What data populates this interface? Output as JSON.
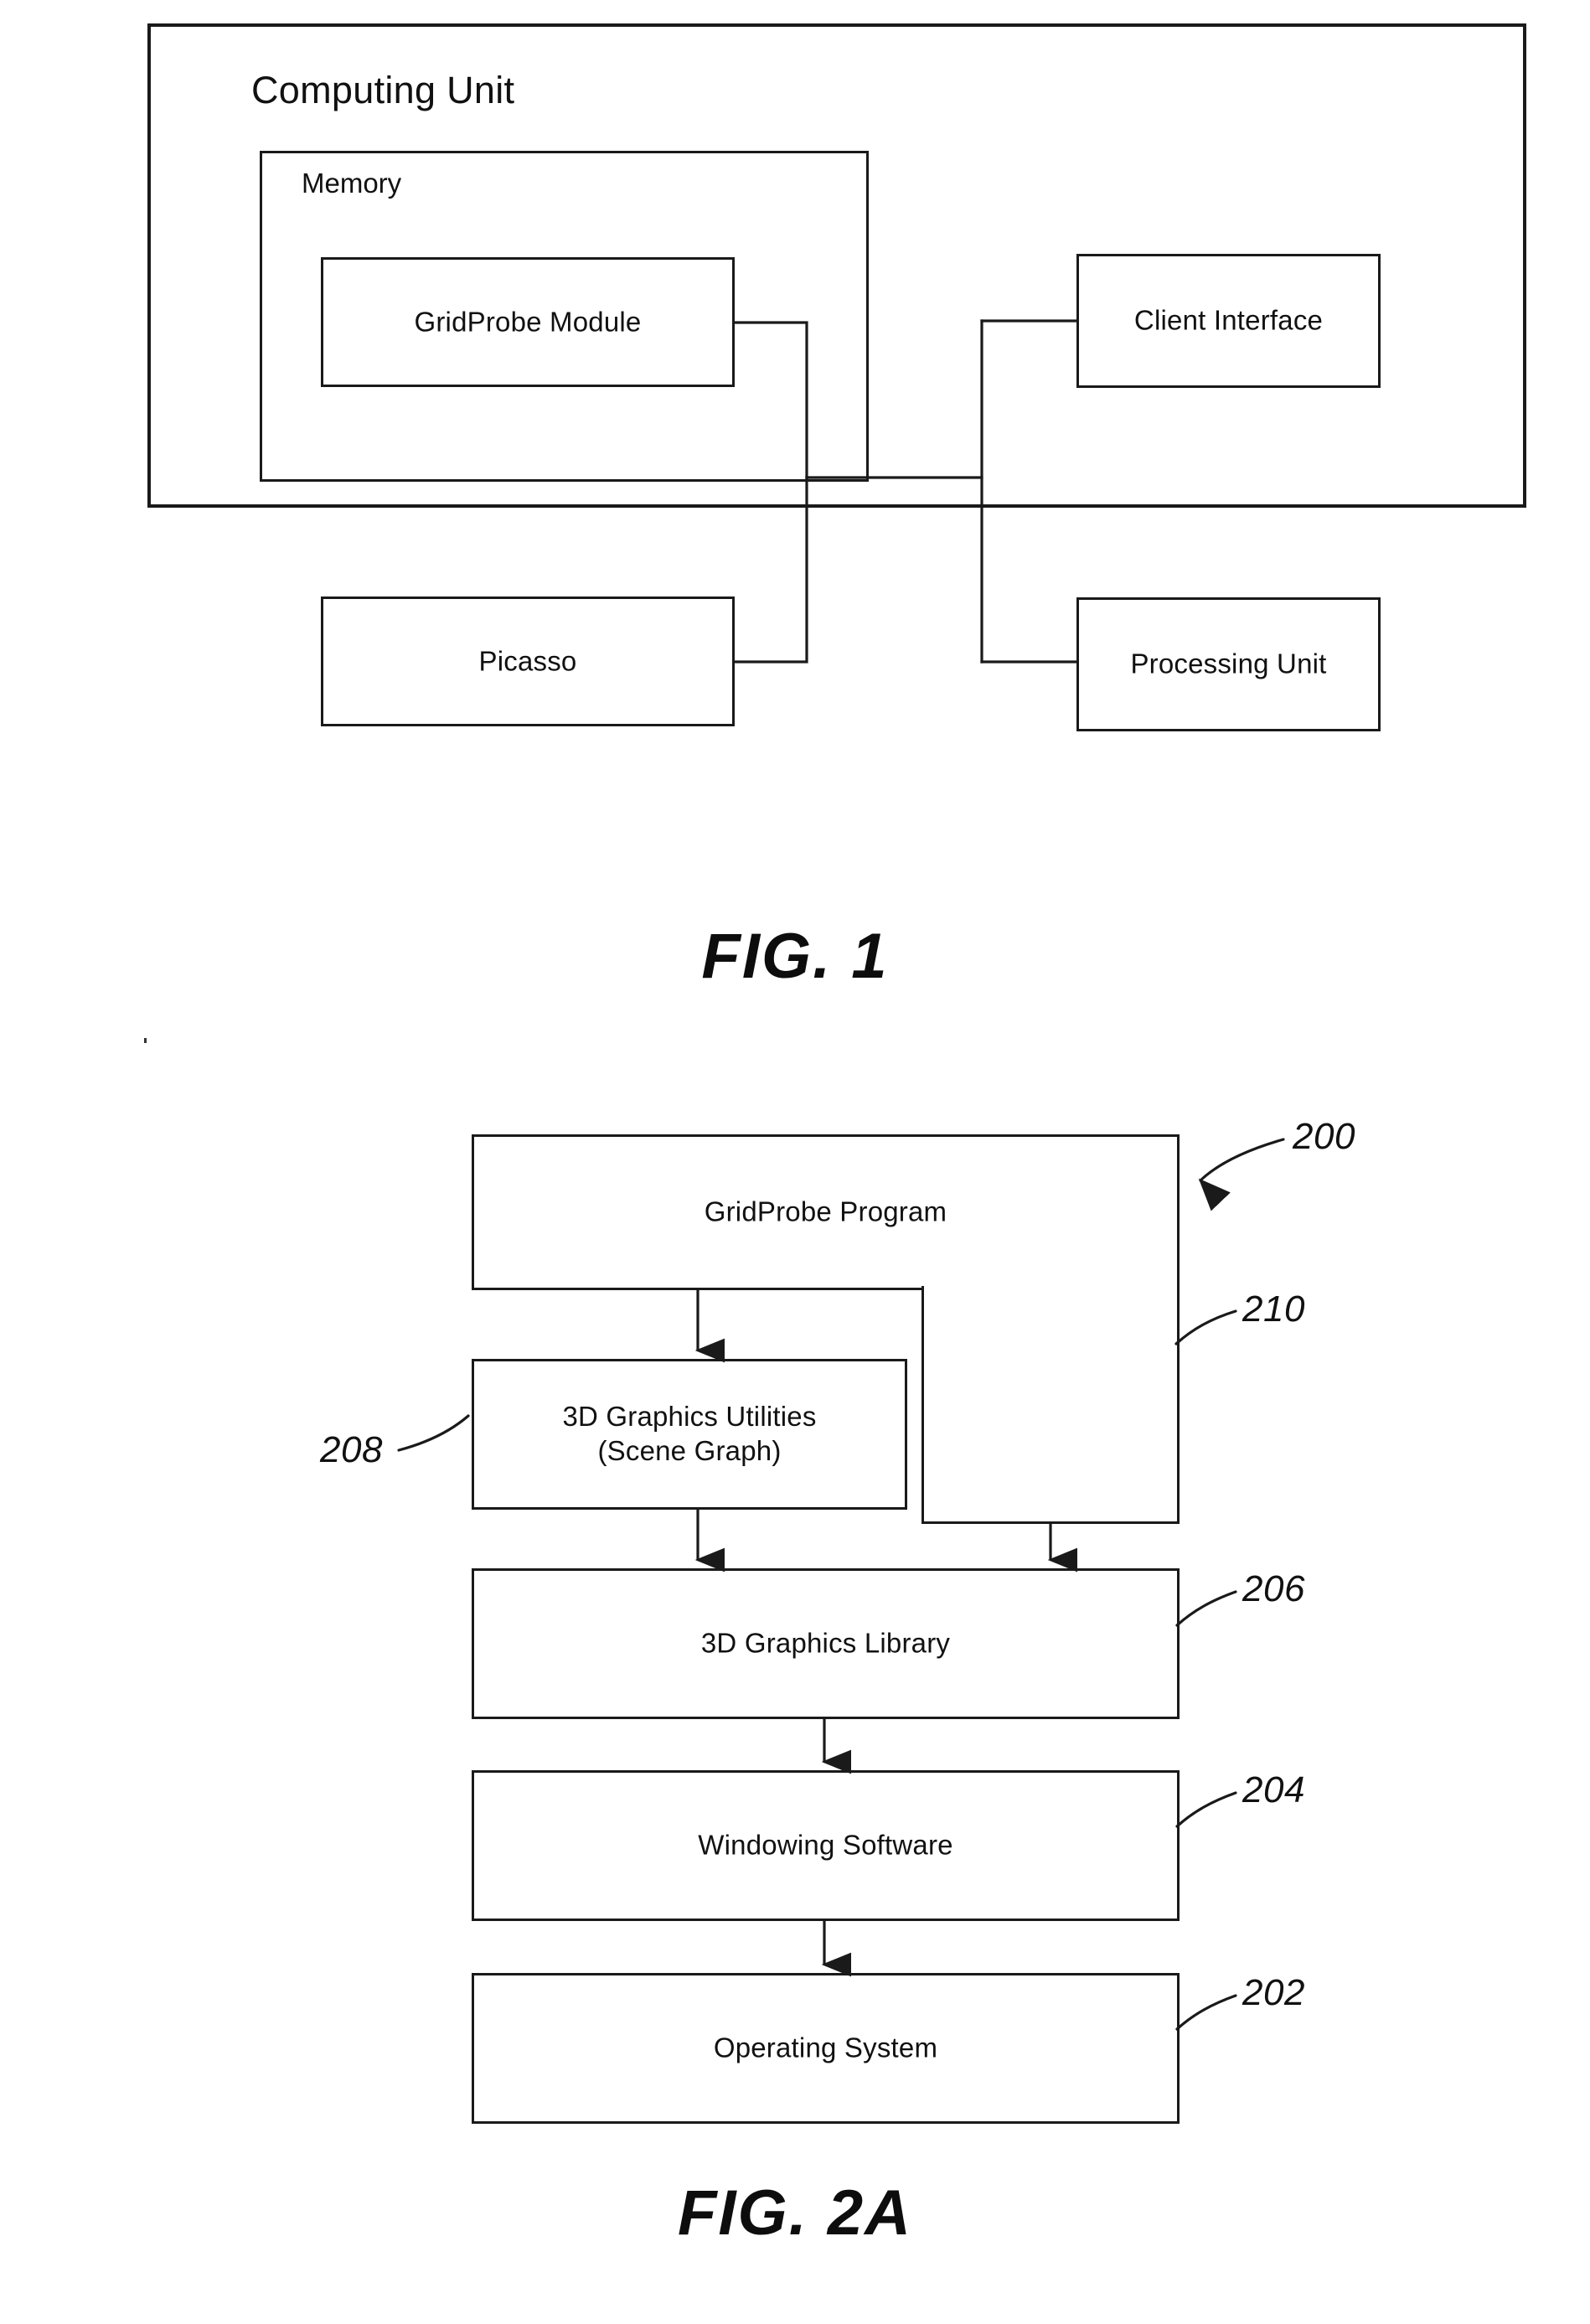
{
  "figure1": {
    "caption": "FIG. 1",
    "outer_title": "Computing Unit",
    "memory_title": "Memory",
    "blocks": [
      {
        "id": "gridprobe-module",
        "label": "GridProbe Module"
      },
      {
        "id": "picasso",
        "label": "Picasso"
      },
      {
        "id": "client-interface",
        "label": "Client Interface"
      },
      {
        "id": "processing-unit",
        "label": "Processing Unit"
      }
    ]
  },
  "figure2a": {
    "caption": "FIG. 2A",
    "blocks": [
      {
        "id": "gridprobe-program",
        "label": "GridProbe Program",
        "ref": "200"
      },
      {
        "id": "graphics-utilities",
        "label": "3D Graphics Utilities\n(Scene Graph)",
        "ref": "208"
      },
      {
        "id": "graphics-library",
        "label": "3D Graphics Library",
        "ref": "206"
      },
      {
        "id": "windowing-software",
        "label": "Windowing Software",
        "ref": "204"
      },
      {
        "id": "operating-system",
        "label": "Operating System",
        "ref": "202"
      }
    ],
    "ref_numbers": {
      "program_stack": "200",
      "program_enclosure": "210",
      "utilities": "208",
      "library": "206",
      "windowing": "204",
      "os": "202"
    }
  },
  "colors": {
    "ink": "#111111",
    "line": "#1a1a1a",
    "paper": "#ffffff"
  }
}
